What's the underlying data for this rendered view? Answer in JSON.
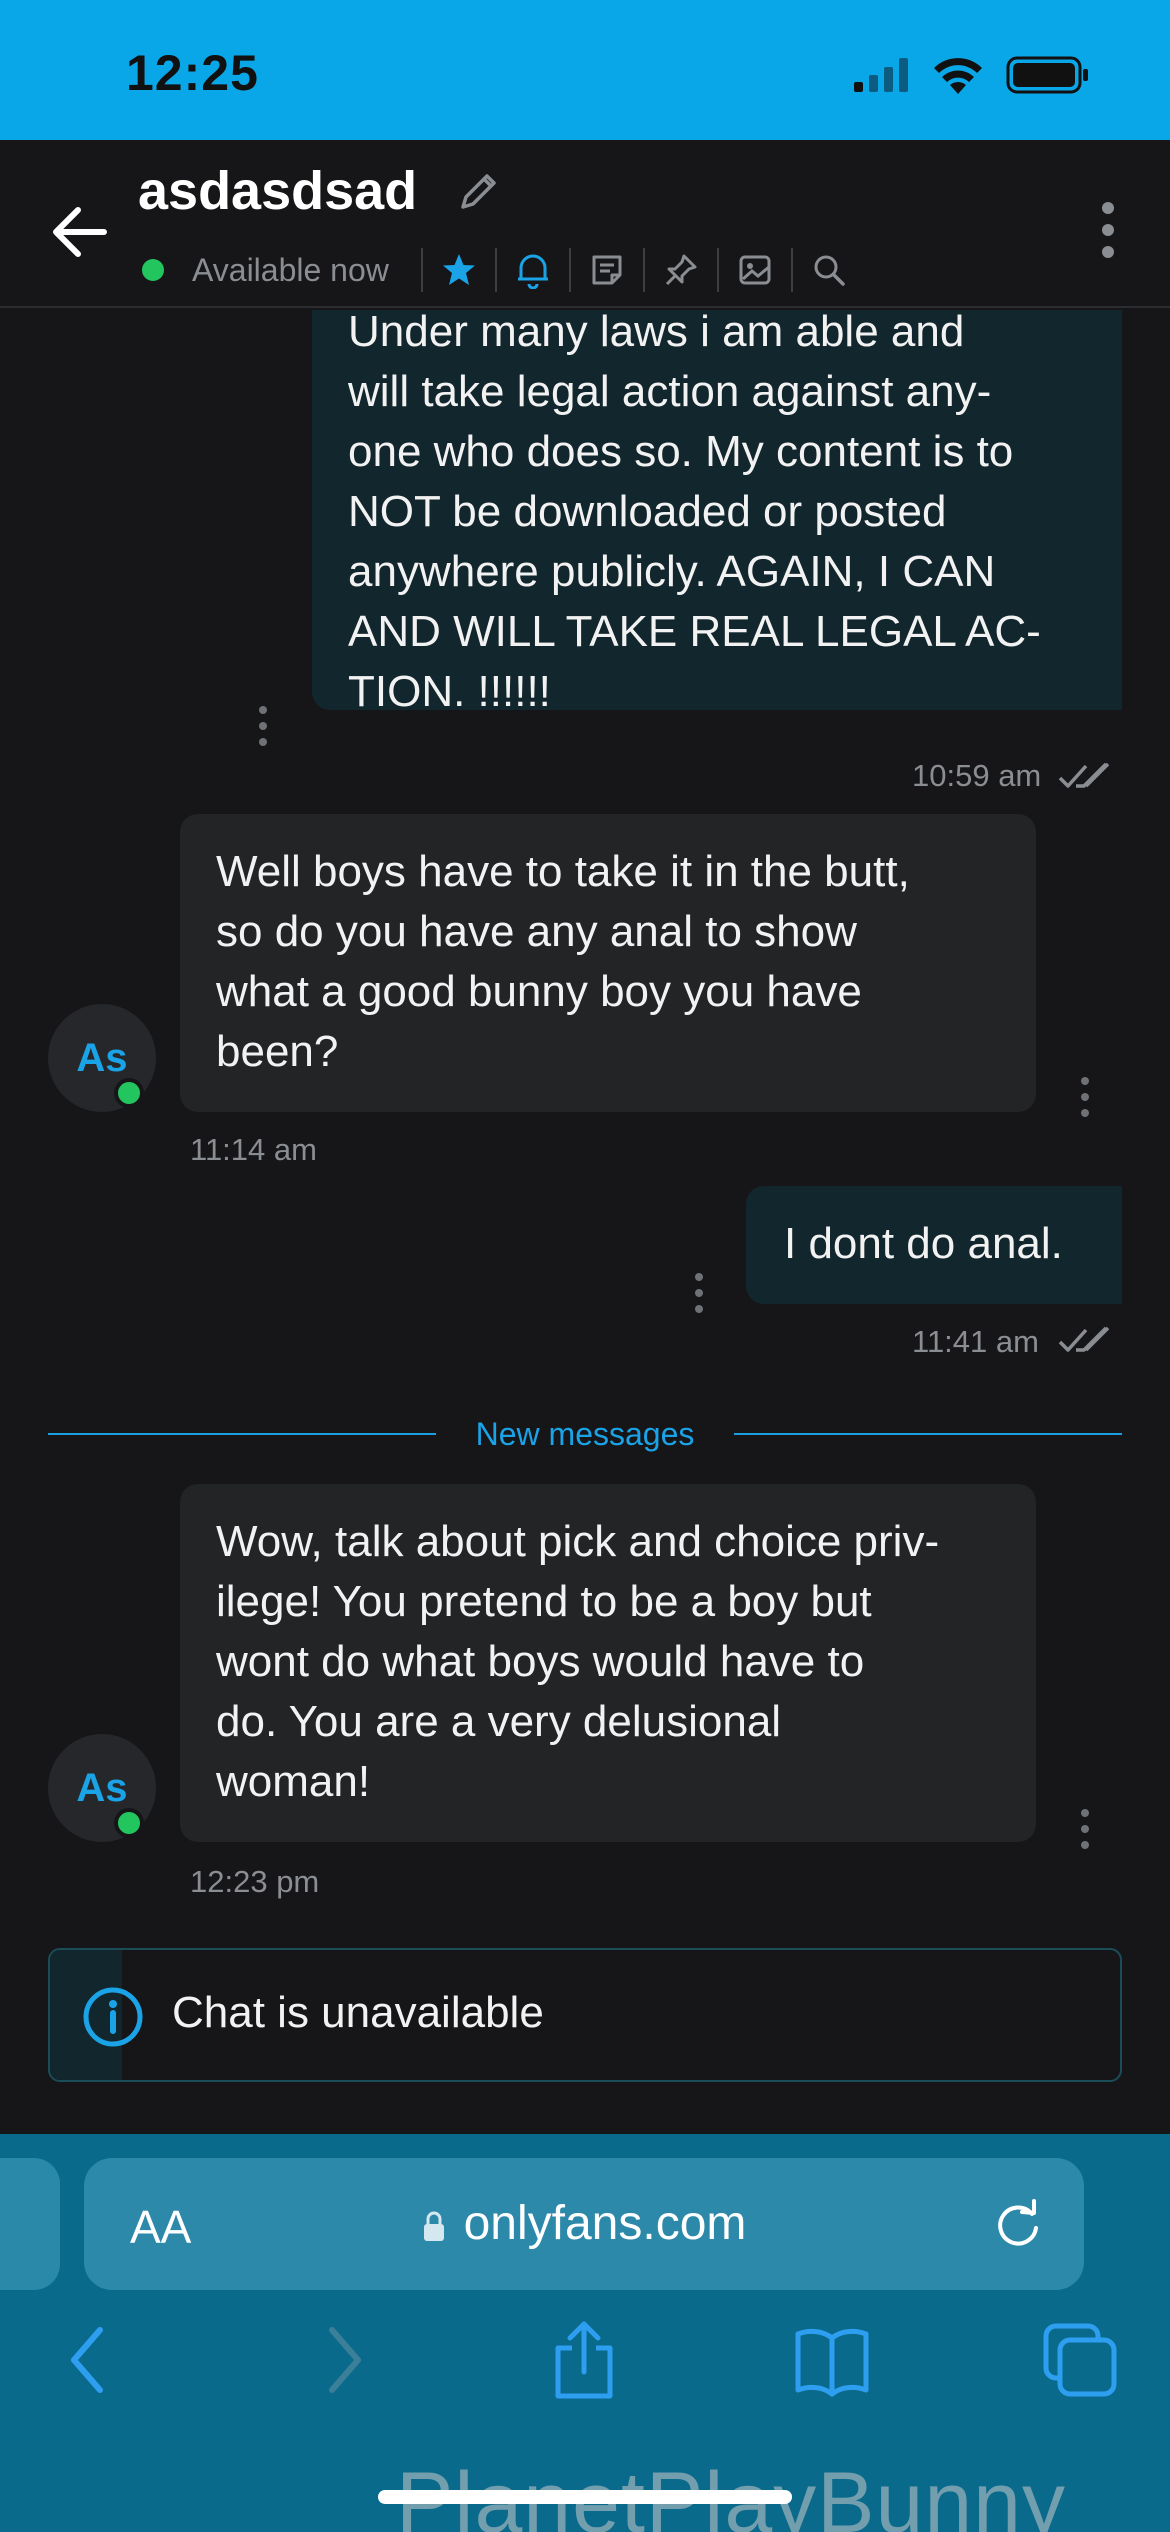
{
  "status_bar": {
    "time": "12:25"
  },
  "header": {
    "name": "asdasdsad",
    "status": "Available now"
  },
  "messages": [
    {
      "direction": "out",
      "lines": [
        "Under many laws i am able and",
        "will take legal action against any-",
        "one who does so. My content is to",
        "NOT be downloaded or posted",
        "anywhere publicly. AGAIN, I CAN",
        "AND WILL TAKE REAL LEGAL AC-",
        "TION. !!!!!!"
      ],
      "time": "10:59 am"
    },
    {
      "direction": "in",
      "avatar": "As",
      "lines": [
        "Well boys have to take it in the butt,",
        "so do you have any anal to show",
        "what a good bunny boy you have",
        "been?"
      ],
      "time": "11:14 am"
    },
    {
      "direction": "out",
      "lines": [
        "I dont do anal."
      ],
      "time": "11:41 am"
    },
    {
      "direction": "in",
      "avatar": "As",
      "lines": [
        "Wow, talk about pick and choice priv-",
        "ilege! You pretend to be a boy but",
        "wont do what boys would have to",
        "do. You are a very delusional",
        "woman!"
      ],
      "time": "12:23 pm"
    }
  ],
  "divider": {
    "label": "New messages"
  },
  "notice": {
    "text": "Chat is unavailable"
  },
  "browser": {
    "text_size_label": "AA",
    "url": "onlyfans.com"
  },
  "watermark": "PlanetPlayBunny",
  "colors": {
    "accent": "#1aa3e6",
    "online": "#23c55e",
    "status_bar": "#0aa7e8",
    "browser_bar": "#0a6a8c"
  }
}
